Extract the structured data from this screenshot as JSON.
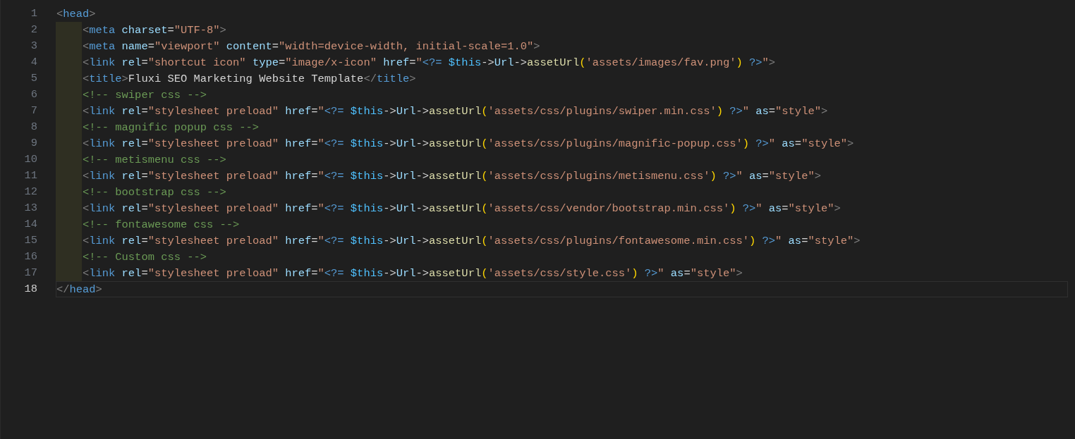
{
  "editor": {
    "lines": [
      {
        "number": "1",
        "current": false,
        "tokens": [
          {
            "kind": "punct",
            "text": "<"
          },
          {
            "kind": "tag",
            "text": "head"
          },
          {
            "kind": "punct",
            "text": ">"
          }
        ],
        "children": [
          {
            "number": "2",
            "current": false,
            "tokens": [
              {
                "kind": "punct",
                "text": "<"
              },
              {
                "kind": "tag",
                "text": "meta"
              },
              {
                "kind": "attr",
                "text": " charset"
              },
              {
                "kind": "plain",
                "text": "="
              },
              {
                "kind": "string",
                "text": "\"UTF-8\""
              },
              {
                "kind": "punct",
                "text": ">"
              }
            ]
          },
          {
            "number": "3",
            "current": false,
            "tokens": [
              {
                "kind": "punct",
                "text": "<"
              },
              {
                "kind": "tag",
                "text": "meta"
              },
              {
                "kind": "attr",
                "text": " name"
              },
              {
                "kind": "plain",
                "text": "="
              },
              {
                "kind": "string",
                "text": "\"viewport\""
              },
              {
                "kind": "attr",
                "text": " content"
              },
              {
                "kind": "plain",
                "text": "="
              },
              {
                "kind": "string",
                "text": "\"width=device-width, initial-scale=1.0\""
              },
              {
                "kind": "punct",
                "text": ">"
              }
            ]
          },
          {
            "number": "4",
            "current": false,
            "tokens": [
              {
                "kind": "punct",
                "text": "<"
              },
              {
                "kind": "tag",
                "text": "link"
              },
              {
                "kind": "attr",
                "text": " rel"
              },
              {
                "kind": "plain",
                "text": "="
              },
              {
                "kind": "string",
                "text": "\"shortcut icon\""
              },
              {
                "kind": "attr",
                "text": " type"
              },
              {
                "kind": "plain",
                "text": "="
              },
              {
                "kind": "string",
                "text": "\"image/x-icon\""
              },
              {
                "kind": "attr",
                "text": " href"
              },
              {
                "kind": "plain",
                "text": "="
              },
              {
                "kind": "string",
                "text": "\""
              },
              {
                "kind": "php",
                "text": "<?="
              },
              {
                "kind": "variable",
                "text": " $this"
              },
              {
                "kind": "plain",
                "text": "->"
              },
              {
                "kind": "member",
                "text": "Url"
              },
              {
                "kind": "plain",
                "text": "->"
              },
              {
                "kind": "function",
                "text": "assetUrl"
              },
              {
                "kind": "paren",
                "text": "("
              },
              {
                "kind": "string",
                "text": "'assets/images/fav.png'"
              },
              {
                "kind": "paren",
                "text": ")"
              },
              {
                "kind": "php",
                "text": " ?>"
              },
              {
                "kind": "string",
                "text": "\""
              },
              {
                "kind": "punct",
                "text": ">"
              }
            ]
          },
          {
            "number": "5",
            "current": false,
            "tokens": [
              {
                "kind": "punct",
                "text": "<"
              },
              {
                "kind": "tag",
                "text": "title"
              },
              {
                "kind": "punct",
                "text": ">"
              },
              {
                "kind": "plain",
                "text": "Fluxi SEO Marketing Website Template"
              },
              {
                "kind": "punct",
                "text": "</"
              },
              {
                "kind": "tag",
                "text": "title"
              },
              {
                "kind": "punct",
                "text": ">"
              }
            ]
          },
          {
            "number": "6",
            "current": false,
            "tokens": [
              {
                "kind": "comment",
                "text": "<!-- swiper css -->"
              }
            ]
          },
          {
            "number": "7",
            "current": false,
            "tokens": [
              {
                "kind": "punct",
                "text": "<"
              },
              {
                "kind": "tag",
                "text": "link"
              },
              {
                "kind": "attr",
                "text": " rel"
              },
              {
                "kind": "plain",
                "text": "="
              },
              {
                "kind": "string",
                "text": "\"stylesheet preload\""
              },
              {
                "kind": "attr",
                "text": " href"
              },
              {
                "kind": "plain",
                "text": "="
              },
              {
                "kind": "string",
                "text": "\""
              },
              {
                "kind": "php",
                "text": "<?="
              },
              {
                "kind": "variable",
                "text": " $this"
              },
              {
                "kind": "plain",
                "text": "->"
              },
              {
                "kind": "member",
                "text": "Url"
              },
              {
                "kind": "plain",
                "text": "->"
              },
              {
                "kind": "function",
                "text": "assetUrl"
              },
              {
                "kind": "paren",
                "text": "("
              },
              {
                "kind": "string",
                "text": "'assets/css/plugins/swiper.min.css'"
              },
              {
                "kind": "paren",
                "text": ")"
              },
              {
                "kind": "php",
                "text": " ?>"
              },
              {
                "kind": "string",
                "text": "\""
              },
              {
                "kind": "attr",
                "text": " as"
              },
              {
                "kind": "plain",
                "text": "="
              },
              {
                "kind": "string",
                "text": "\"style\""
              },
              {
                "kind": "punct",
                "text": ">"
              }
            ]
          },
          {
            "number": "8",
            "current": false,
            "tokens": [
              {
                "kind": "comment",
                "text": "<!-- magnific popup css -->"
              }
            ]
          },
          {
            "number": "9",
            "current": false,
            "tokens": [
              {
                "kind": "punct",
                "text": "<"
              },
              {
                "kind": "tag",
                "text": "link"
              },
              {
                "kind": "attr",
                "text": " rel"
              },
              {
                "kind": "plain",
                "text": "="
              },
              {
                "kind": "string",
                "text": "\"stylesheet preload\""
              },
              {
                "kind": "attr",
                "text": " href"
              },
              {
                "kind": "plain",
                "text": "="
              },
              {
                "kind": "string",
                "text": "\""
              },
              {
                "kind": "php",
                "text": "<?="
              },
              {
                "kind": "variable",
                "text": " $this"
              },
              {
                "kind": "plain",
                "text": "->"
              },
              {
                "kind": "member",
                "text": "Url"
              },
              {
                "kind": "plain",
                "text": "->"
              },
              {
                "kind": "function",
                "text": "assetUrl"
              },
              {
                "kind": "paren",
                "text": "("
              },
              {
                "kind": "string",
                "text": "'assets/css/plugins/magnific-popup.css'"
              },
              {
                "kind": "paren",
                "text": ")"
              },
              {
                "kind": "php",
                "text": " ?>"
              },
              {
                "kind": "string",
                "text": "\""
              },
              {
                "kind": "attr",
                "text": " as"
              },
              {
                "kind": "plain",
                "text": "="
              },
              {
                "kind": "string",
                "text": "\"style\""
              },
              {
                "kind": "punct",
                "text": ">"
              }
            ]
          },
          {
            "number": "10",
            "current": false,
            "tokens": [
              {
                "kind": "comment",
                "text": "<!-- metismenu css -->"
              }
            ]
          },
          {
            "number": "11",
            "current": false,
            "tokens": [
              {
                "kind": "punct",
                "text": "<"
              },
              {
                "kind": "tag",
                "text": "link"
              },
              {
                "kind": "attr",
                "text": " rel"
              },
              {
                "kind": "plain",
                "text": "="
              },
              {
                "kind": "string",
                "text": "\"stylesheet preload\""
              },
              {
                "kind": "attr",
                "text": " href"
              },
              {
                "kind": "plain",
                "text": "="
              },
              {
                "kind": "string",
                "text": "\""
              },
              {
                "kind": "php",
                "text": "<?="
              },
              {
                "kind": "variable",
                "text": " $this"
              },
              {
                "kind": "plain",
                "text": "->"
              },
              {
                "kind": "member",
                "text": "Url"
              },
              {
                "kind": "plain",
                "text": "->"
              },
              {
                "kind": "function",
                "text": "assetUrl"
              },
              {
                "kind": "paren",
                "text": "("
              },
              {
                "kind": "string",
                "text": "'assets/css/plugins/metismenu.css'"
              },
              {
                "kind": "paren",
                "text": ")"
              },
              {
                "kind": "php",
                "text": " ?>"
              },
              {
                "kind": "string",
                "text": "\""
              },
              {
                "kind": "attr",
                "text": " as"
              },
              {
                "kind": "plain",
                "text": "="
              },
              {
                "kind": "string",
                "text": "\"style\""
              },
              {
                "kind": "punct",
                "text": ">"
              }
            ]
          },
          {
            "number": "12",
            "current": false,
            "tokens": [
              {
                "kind": "comment",
                "text": "<!-- bootstrap css -->"
              }
            ]
          },
          {
            "number": "13",
            "current": false,
            "tokens": [
              {
                "kind": "punct",
                "text": "<"
              },
              {
                "kind": "tag",
                "text": "link"
              },
              {
                "kind": "attr",
                "text": " rel"
              },
              {
                "kind": "plain",
                "text": "="
              },
              {
                "kind": "string",
                "text": "\"stylesheet preload\""
              },
              {
                "kind": "attr",
                "text": " href"
              },
              {
                "kind": "plain",
                "text": "="
              },
              {
                "kind": "string",
                "text": "\""
              },
              {
                "kind": "php",
                "text": "<?="
              },
              {
                "kind": "variable",
                "text": " $this"
              },
              {
                "kind": "plain",
                "text": "->"
              },
              {
                "kind": "member",
                "text": "Url"
              },
              {
                "kind": "plain",
                "text": "->"
              },
              {
                "kind": "function",
                "text": "assetUrl"
              },
              {
                "kind": "paren",
                "text": "("
              },
              {
                "kind": "string",
                "text": "'assets/css/vendor/bootstrap.min.css'"
              },
              {
                "kind": "paren",
                "text": ")"
              },
              {
                "kind": "php",
                "text": " ?>"
              },
              {
                "kind": "string",
                "text": "\""
              },
              {
                "kind": "attr",
                "text": " as"
              },
              {
                "kind": "plain",
                "text": "="
              },
              {
                "kind": "string",
                "text": "\"style\""
              },
              {
                "kind": "punct",
                "text": ">"
              }
            ]
          },
          {
            "number": "14",
            "current": false,
            "tokens": [
              {
                "kind": "comment",
                "text": "<!-- fontawesome css -->"
              }
            ]
          },
          {
            "number": "15",
            "current": false,
            "tokens": [
              {
                "kind": "punct",
                "text": "<"
              },
              {
                "kind": "tag",
                "text": "link"
              },
              {
                "kind": "attr",
                "text": " rel"
              },
              {
                "kind": "plain",
                "text": "="
              },
              {
                "kind": "string",
                "text": "\"stylesheet preload\""
              },
              {
                "kind": "attr",
                "text": " href"
              },
              {
                "kind": "plain",
                "text": "="
              },
              {
                "kind": "string",
                "text": "\""
              },
              {
                "kind": "php",
                "text": "<?="
              },
              {
                "kind": "variable",
                "text": " $this"
              },
              {
                "kind": "plain",
                "text": "->"
              },
              {
                "kind": "member",
                "text": "Url"
              },
              {
                "kind": "plain",
                "text": "->"
              },
              {
                "kind": "function",
                "text": "assetUrl"
              },
              {
                "kind": "paren",
                "text": "("
              },
              {
                "kind": "string",
                "text": "'assets/css/plugins/fontawesome.min.css'"
              },
              {
                "kind": "paren",
                "text": ")"
              },
              {
                "kind": "php",
                "text": " ?>"
              },
              {
                "kind": "string",
                "text": "\""
              },
              {
                "kind": "attr",
                "text": " as"
              },
              {
                "kind": "plain",
                "text": "="
              },
              {
                "kind": "string",
                "text": "\"style\""
              },
              {
                "kind": "punct",
                "text": ">"
              }
            ]
          },
          {
            "number": "16",
            "current": false,
            "tokens": [
              {
                "kind": "comment",
                "text": "<!-- Custom css -->"
              }
            ]
          },
          {
            "number": "17",
            "current": false,
            "tokens": [
              {
                "kind": "punct",
                "text": "<"
              },
              {
                "kind": "tag",
                "text": "link"
              },
              {
                "kind": "attr",
                "text": " rel"
              },
              {
                "kind": "plain",
                "text": "="
              },
              {
                "kind": "string",
                "text": "\"stylesheet preload\""
              },
              {
                "kind": "attr",
                "text": " href"
              },
              {
                "kind": "plain",
                "text": "="
              },
              {
                "kind": "string",
                "text": "\""
              },
              {
                "kind": "php",
                "text": "<?="
              },
              {
                "kind": "variable",
                "text": " $this"
              },
              {
                "kind": "plain",
                "text": "->"
              },
              {
                "kind": "member",
                "text": "Url"
              },
              {
                "kind": "plain",
                "text": "->"
              },
              {
                "kind": "function",
                "text": "assetUrl"
              },
              {
                "kind": "paren",
                "text": "("
              },
              {
                "kind": "string",
                "text": "'assets/css/style.css'"
              },
              {
                "kind": "paren",
                "text": ")"
              },
              {
                "kind": "php",
                "text": " ?>"
              },
              {
                "kind": "string",
                "text": "\""
              },
              {
                "kind": "attr",
                "text": " as"
              },
              {
                "kind": "plain",
                "text": "="
              },
              {
                "kind": "string",
                "text": "\"style\""
              },
              {
                "kind": "punct",
                "text": ">"
              }
            ]
          }
        ]
      },
      {
        "number": "18",
        "current": true,
        "tokens": [
          {
            "kind": "punct",
            "text": "</"
          },
          {
            "kind": "tag",
            "text": "head"
          },
          {
            "kind": "punct",
            "text": ">"
          }
        ]
      }
    ]
  }
}
